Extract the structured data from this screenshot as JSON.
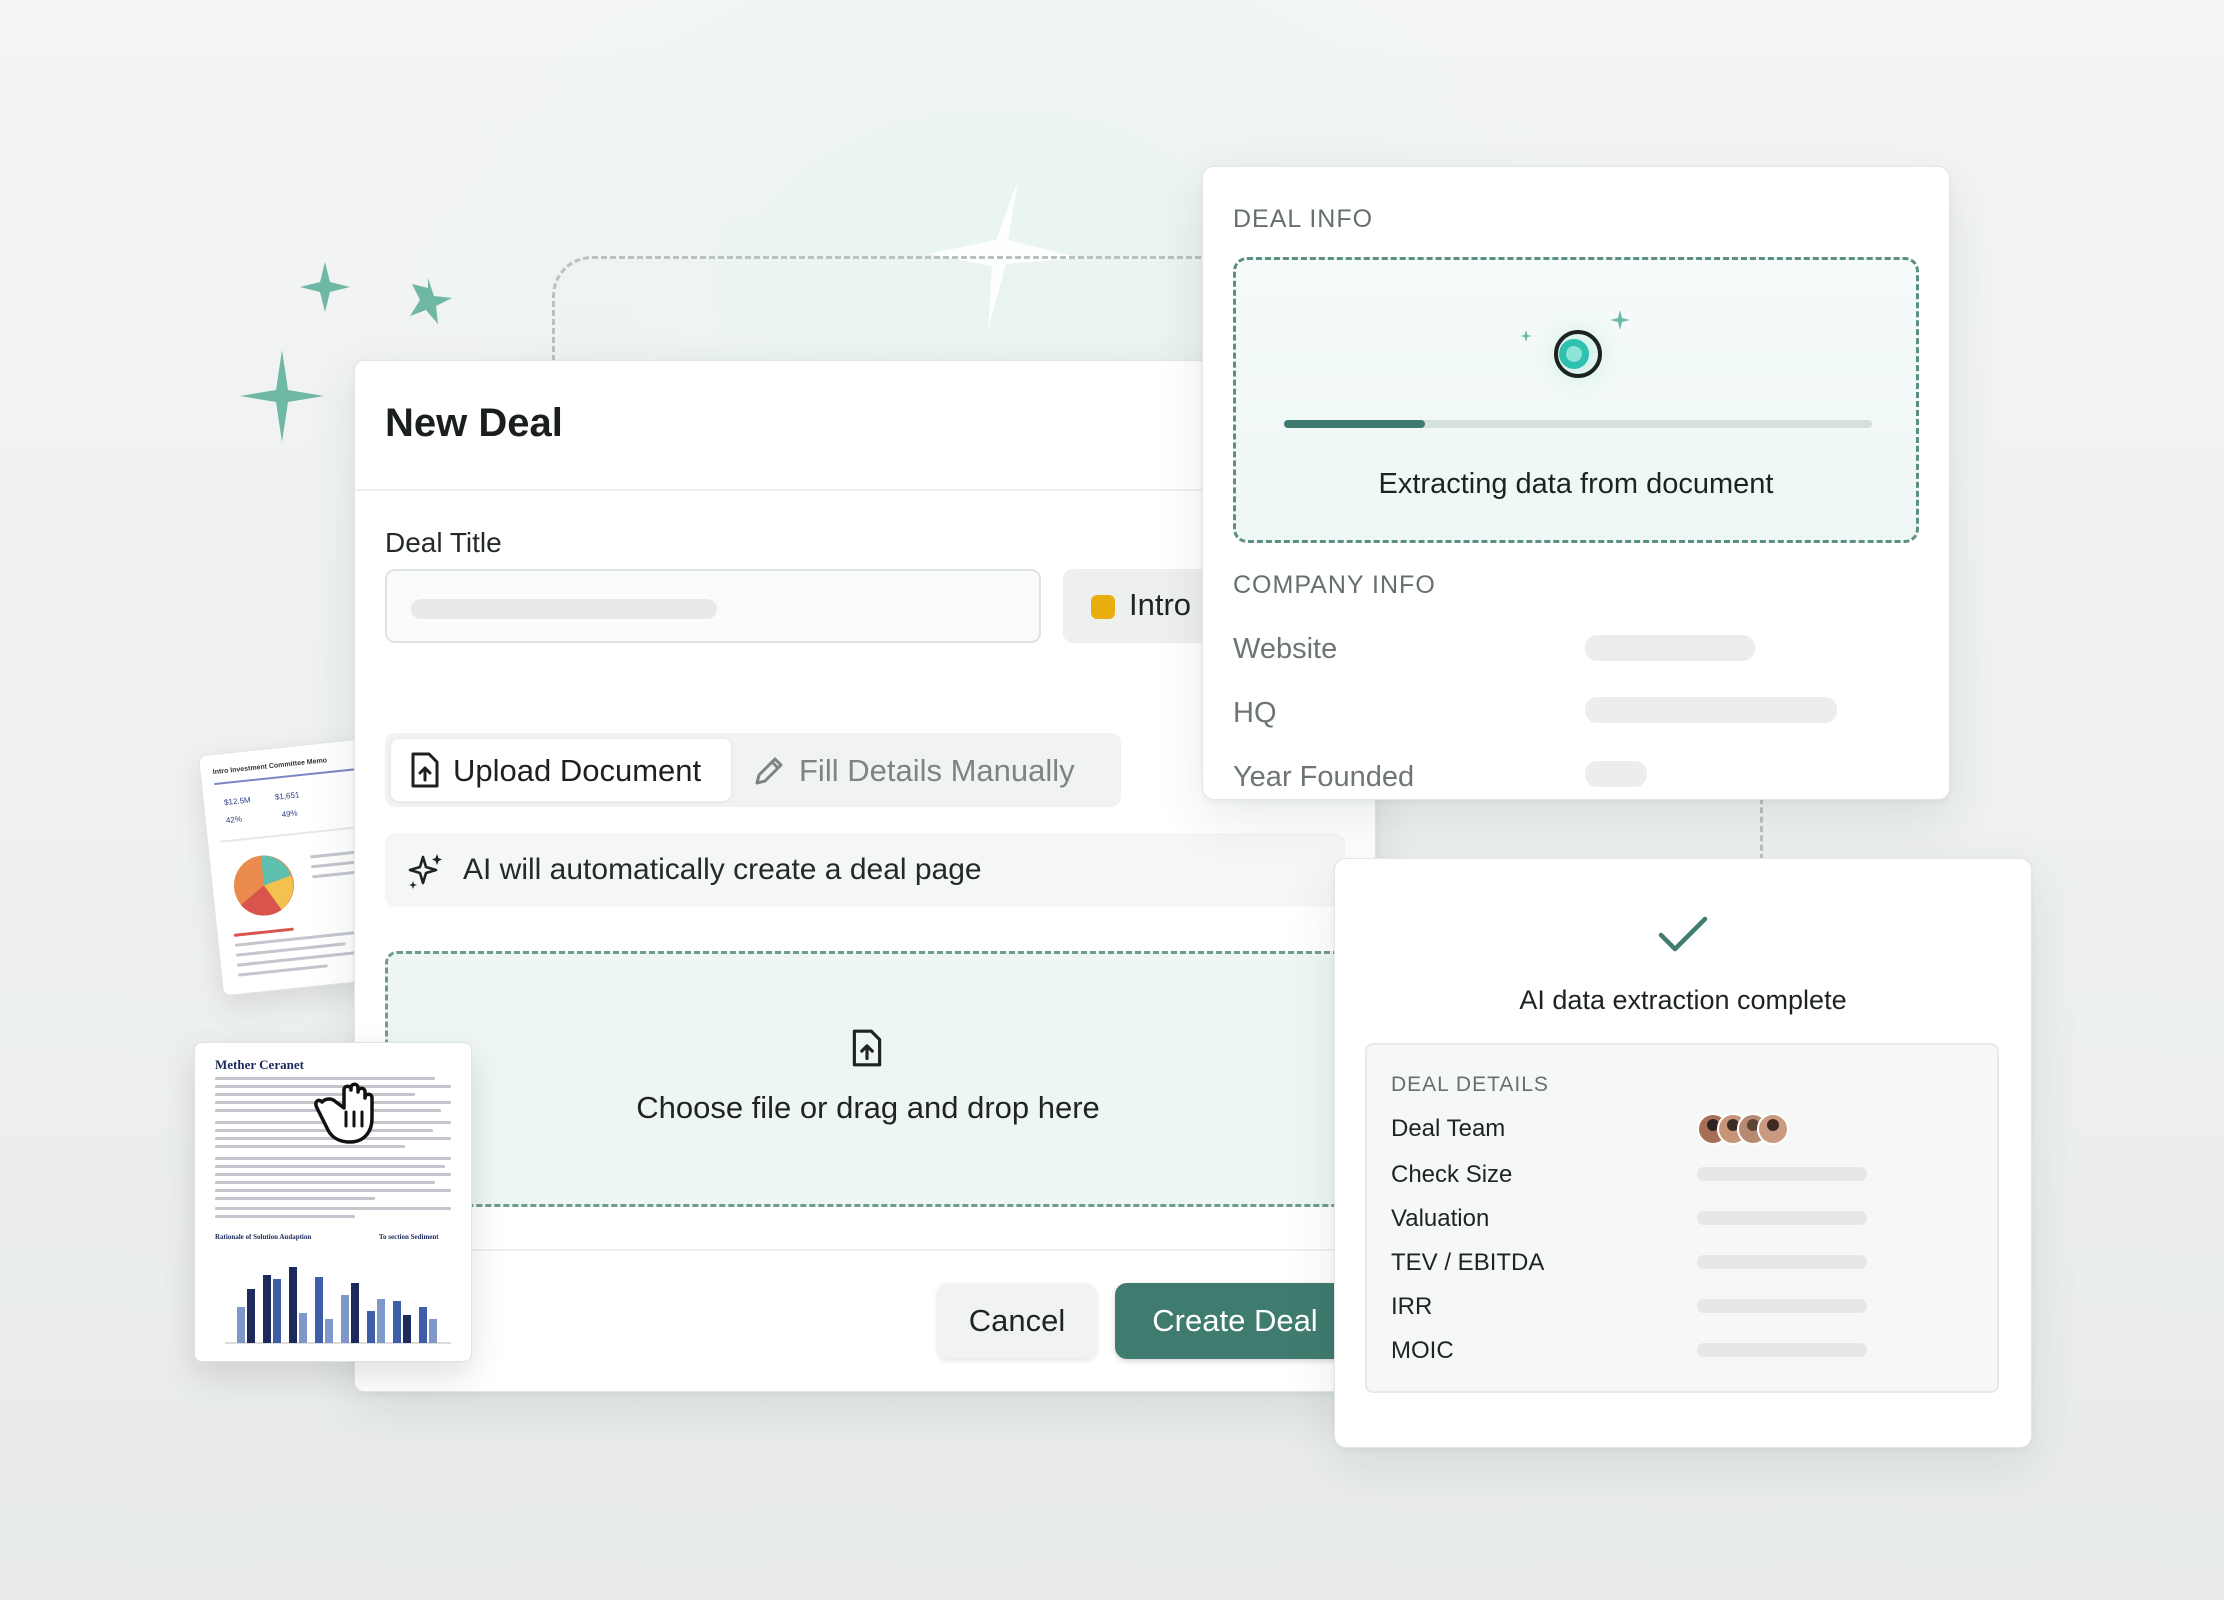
{
  "new_deal": {
    "title": "New Deal",
    "deal_title_label": "Deal Title",
    "stage_label": "Intro",
    "tabs": [
      {
        "label": "Upload Document",
        "icon": "file-upload-icon",
        "selected": true
      },
      {
        "label": "Fill Details Manually",
        "icon": "pencil-icon",
        "selected": false
      }
    ],
    "ai_banner": "AI will automatically create a deal page",
    "dropzone_text": "Choose file or drag and drop here",
    "cancel_label": "Cancel",
    "create_label": "Create Deal"
  },
  "deal_info": {
    "section_title": "DEAL INFO",
    "extract_status": "Extracting data from document",
    "progress": 0.24,
    "company_section": "COMPANY INFO",
    "fields": [
      "Website",
      "HQ",
      "Year Founded"
    ]
  },
  "extraction_complete": {
    "title": "AI data extraction complete",
    "section_title": "DEAL DETAILS",
    "rows": [
      "Deal Team",
      "Check Size",
      "Valuation",
      "TEV / EBITDA",
      "IRR",
      "MOIC"
    ]
  },
  "documents": {
    "memo_title": "Intro Investment Committee Memo",
    "doc_title": "Mether Ceranet",
    "chart_left": "Rationale of Solution Audaption",
    "chart_right": "To section Sediment"
  },
  "colors": {
    "accent": "#3f7b6e",
    "stage_dot": "#e9ad0d",
    "sparkle": "#6fb8a6"
  }
}
